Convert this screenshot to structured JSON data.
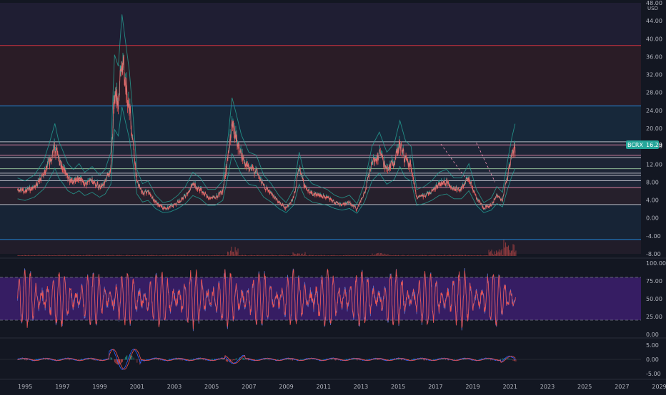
{
  "app": {
    "symbol": "BCRX",
    "price_label": "16.29",
    "currency": "USD"
  },
  "colors": {
    "background": "#131722",
    "axis_text": "#b2b5be",
    "candle_up": "#26a69a",
    "candle_down": "#ef5350",
    "band": "#26a69a",
    "price_line": "#e57373",
    "rsi_fill": "#3d1f6e",
    "rsi_line_a": "#ef5350",
    "rsi_line_b": "#5c6bc0",
    "macd_a": "#2962ff",
    "macd_b": "#ef5350",
    "volume": "#ef5350",
    "hline_red": "#f23645",
    "hline_blue": "#2196f3",
    "hline_white": "#d1d4dc",
    "hline_green": "#a5d6a7",
    "hline_pink": "#f48fb1",
    "label_bg": "#26a69a"
  },
  "chart_data": [
    {
      "type": "line",
      "pane": "price",
      "x_ticks": [
        "1995",
        "1997",
        "1999",
        "2001",
        "2003",
        "2005",
        "2007",
        "2009",
        "2011",
        "2013",
        "2015",
        "2017",
        "2019",
        "2021",
        "2023",
        "2025",
        "2027",
        "2029"
      ],
      "y_ticks": [
        "48.00",
        "44.00",
        "40.00",
        "36.00",
        "32.00",
        "28.00",
        "24.00",
        "20.00",
        "16.00",
        "12.00",
        "8.00",
        "4.00",
        "0.00",
        "-4.00",
        "-8.00"
      ],
      "ylim": [
        -8,
        48
      ],
      "xlim": [
        1994.5,
        2029.6
      ],
      "unit": "USD",
      "series": [
        {
          "x": [
            1994.6,
            1995.0,
            1995.5,
            1996.0,
            1996.3,
            1996.6,
            1996.8,
            1997.0,
            1997.3,
            1997.6,
            1997.9,
            1998.2,
            1998.6,
            1999.0,
            1999.3,
            1999.6,
            1999.8,
            2000.0,
            2000.2,
            2000.4,
            2000.6,
            2000.8,
            2001.0,
            2001.3,
            2001.6,
            2002.0,
            2002.4,
            2002.8,
            2003.2,
            2003.6,
            2004.0,
            2004.4,
            2004.8,
            2005.2,
            2005.6,
            2005.9,
            2006.1,
            2006.3,
            2006.6,
            2007.0,
            2007.4,
            2007.8,
            2008.2,
            2008.6,
            2009.0,
            2009.4,
            2009.7,
            2010.0,
            2010.4,
            2010.8,
            2011.2,
            2011.6,
            2012.0,
            2012.4,
            2012.8,
            2013.2,
            2013.6,
            2014.0,
            2014.4,
            2014.8,
            2015.1,
            2015.4,
            2015.7,
            2016.0,
            2016.4,
            2016.8,
            2017.2,
            2017.6,
            2018.0,
            2018.4,
            2018.8,
            2019.2,
            2019.6,
            2020.0,
            2020.3,
            2020.6,
            2020.9,
            2021.1,
            2021.3
          ],
          "y": [
            6.5,
            6.0,
            7.0,
            9.5,
            12.5,
            16.0,
            13.0,
            11.5,
            9.0,
            8.0,
            9.0,
            7.5,
            8.5,
            7.0,
            8.0,
            11.0,
            28.0,
            26.0,
            35.0,
            30.0,
            25.0,
            17.0,
            8.0,
            5.5,
            6.0,
            3.5,
            2.2,
            2.5,
            3.5,
            5.0,
            7.5,
            6.5,
            4.5,
            4.5,
            6.0,
            14.0,
            20.5,
            18.0,
            14.0,
            11.0,
            10.5,
            7.0,
            5.5,
            3.5,
            2.2,
            4.5,
            11.0,
            7.0,
            5.5,
            5.0,
            4.5,
            3.5,
            3.0,
            3.5,
            2.0,
            5.5,
            12.0,
            14.5,
            11.0,
            12.5,
            16.5,
            13.0,
            12.0,
            4.5,
            5.0,
            6.0,
            7.5,
            8.0,
            6.5,
            6.5,
            9.0,
            4.5,
            2.2,
            3.0,
            5.0,
            4.0,
            10.0,
            13.5,
            16.3
          ]
        }
      ],
      "horizontal_levels": [
        {
          "value": 38.5,
          "color": "red"
        },
        {
          "value": 25.0,
          "color": "blue"
        },
        {
          "value": 17.0,
          "color": "white"
        },
        {
          "value": 16.3,
          "color": "pink"
        },
        {
          "value": 14.0,
          "color": "pink"
        },
        {
          "value": 13.5,
          "color": "white"
        },
        {
          "value": 11.0,
          "color": "green"
        },
        {
          "value": 10.0,
          "color": "white"
        },
        {
          "value": 9.5,
          "color": "white"
        },
        {
          "value": 8.3,
          "color": "white"
        },
        {
          "value": 6.8,
          "color": "pink"
        },
        {
          "value": 3.0,
          "color": "white"
        },
        {
          "value": -4.8,
          "color": "blue"
        }
      ]
    },
    {
      "type": "line",
      "pane": "rsi",
      "y_ticks": [
        "100.00",
        "75.00",
        "50.00",
        "25.00",
        "0.00"
      ],
      "ylim": [
        0,
        100
      ],
      "band": [
        20,
        80
      ]
    },
    {
      "type": "line",
      "pane": "macd",
      "y_ticks": [
        "5.00",
        "0.00",
        "-5.00"
      ],
      "ylim": [
        -7.5,
        7.5
      ]
    }
  ]
}
